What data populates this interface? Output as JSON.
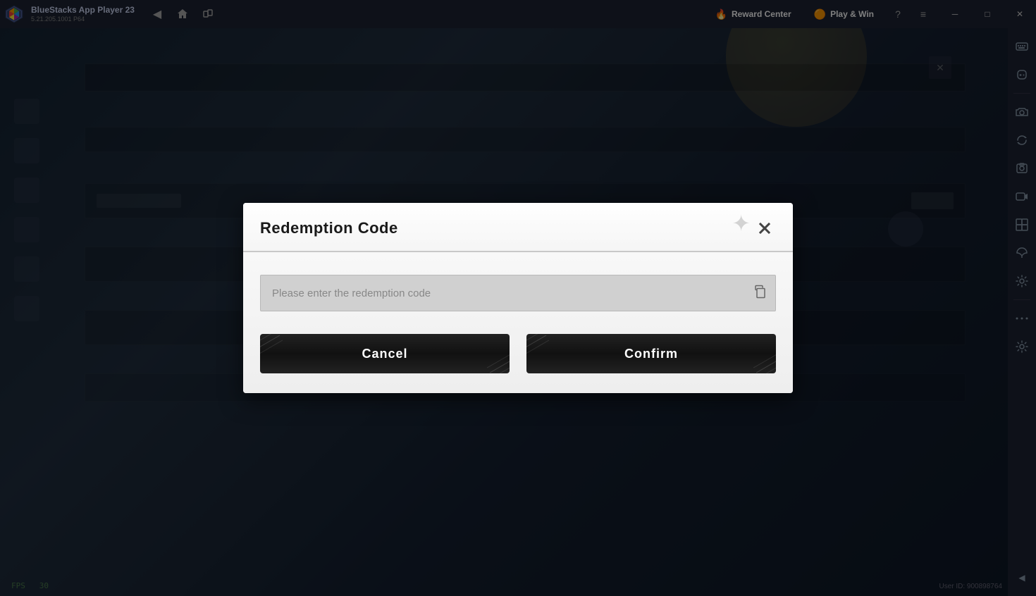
{
  "titlebar": {
    "app_name": "BlueStacks App Player 23",
    "app_version": "5.21.205.1001 P64",
    "reward_center_label": "Reward Center",
    "play_win_label": "Play & Win",
    "back_icon": "◀",
    "home_icon": "⌂",
    "window_icon": "❐",
    "help_icon": "?",
    "menu_icon": "≡",
    "minimize_icon": "─",
    "maximize_icon": "□",
    "close_icon": "✕"
  },
  "sidebar": {
    "icons": [
      {
        "name": "keyboard-icon",
        "symbol": "⌨",
        "interactable": true
      },
      {
        "name": "controller-icon",
        "symbol": "🎮",
        "interactable": true
      },
      {
        "name": "camera-icon",
        "symbol": "📷",
        "interactable": true
      },
      {
        "name": "sync-icon",
        "symbol": "🔄",
        "interactable": true
      },
      {
        "name": "screenshot-icon",
        "symbol": "📸",
        "interactable": true
      },
      {
        "name": "record-icon",
        "symbol": "⏺",
        "interactable": true
      },
      {
        "name": "multi-icon",
        "symbol": "⧉",
        "interactable": true
      },
      {
        "name": "eco-icon",
        "symbol": "🌿",
        "interactable": true
      },
      {
        "name": "settings-icon",
        "symbol": "⚙",
        "interactable": true
      },
      {
        "name": "more-icon",
        "symbol": "···",
        "interactable": true
      },
      {
        "name": "settings2-icon",
        "symbol": "⚙",
        "interactable": true
      },
      {
        "name": "arrow-left-icon",
        "symbol": "◀",
        "interactable": true
      }
    ]
  },
  "dialog": {
    "title": "Redemption Code",
    "input_placeholder": "Please enter the redemption code",
    "cancel_label": "Cancel",
    "confirm_label": "Confirm",
    "close_label": "✕"
  },
  "footer": {
    "fps_label": "FPS",
    "fps_value": "30",
    "user_id_label": "User ID: 900898764"
  }
}
